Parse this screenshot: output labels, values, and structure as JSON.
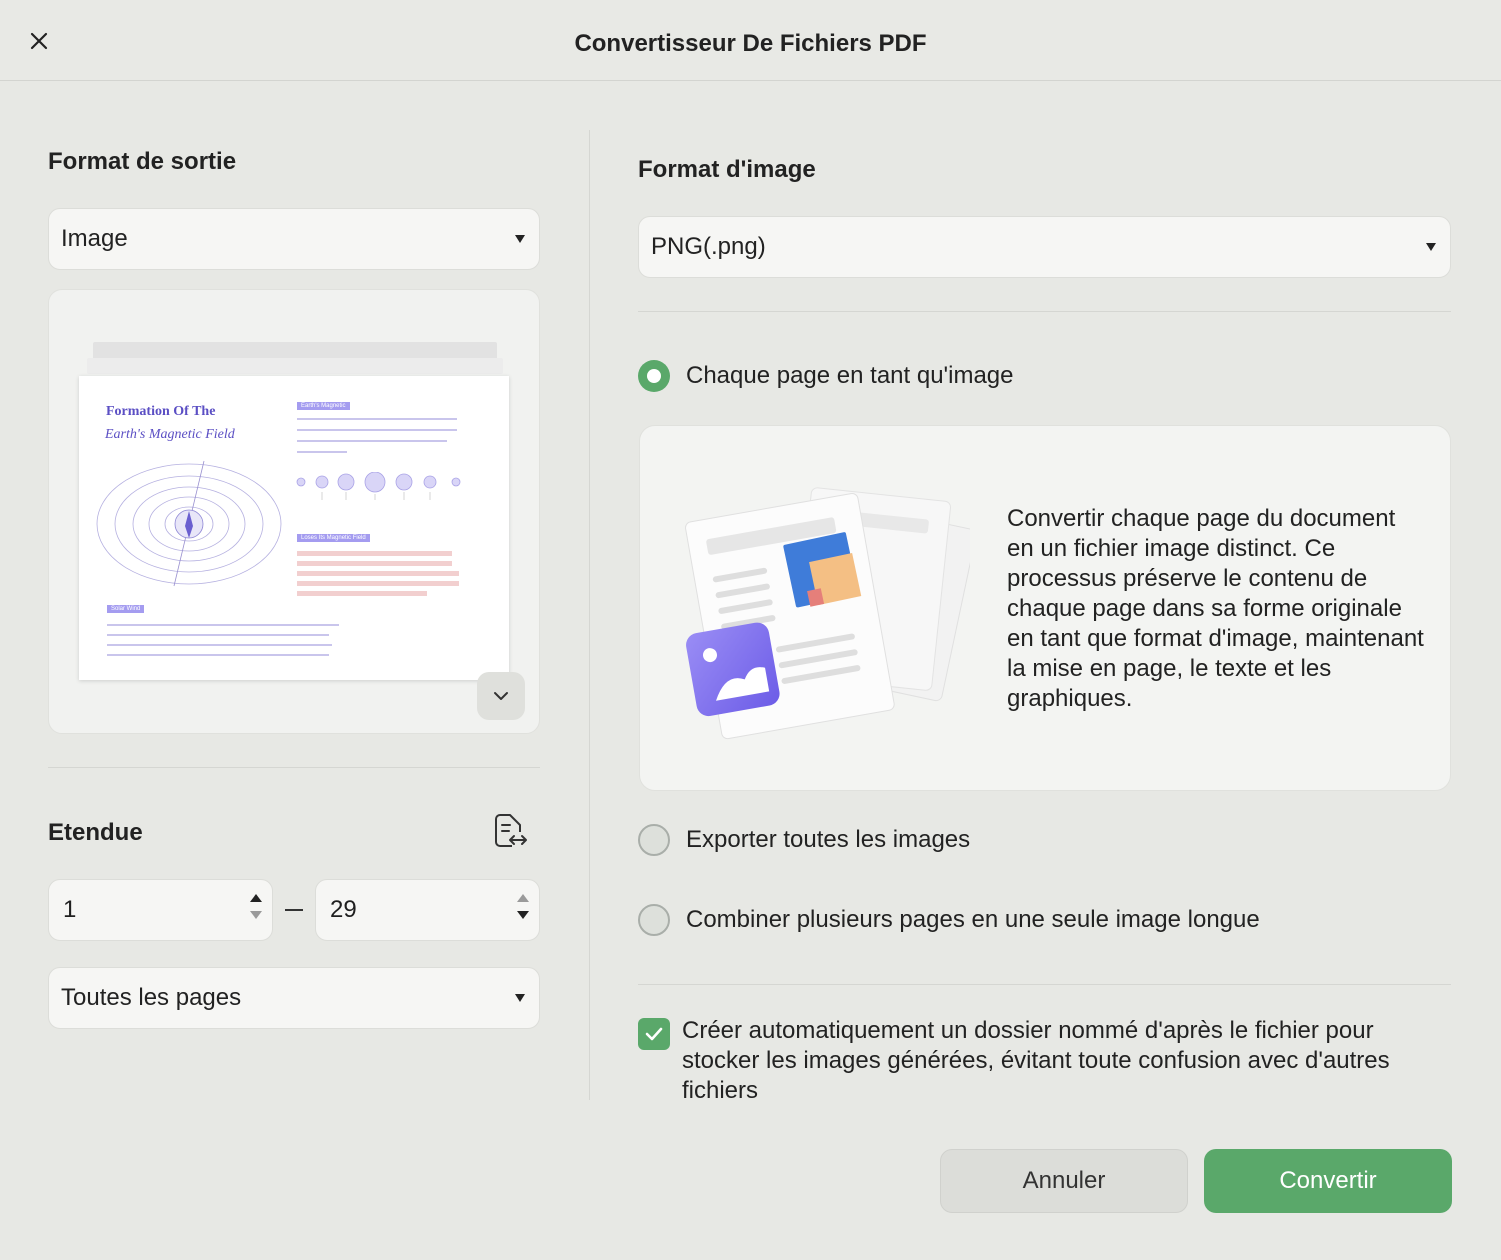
{
  "window": {
    "title": "Convertisseur De Fichiers PDF",
    "close_icon": "close-icon"
  },
  "left": {
    "output_format_label": "Format de sortie",
    "output_format_value": "Image",
    "preview": {
      "doc_title_line1": "Formation Of The",
      "doc_title_line2": "Earth's Magnetic Field",
      "tag_1": "Earth's Magnetic",
      "tag_2": "Loses Its Magnetic Field",
      "tag_3": "Solar Wind"
    },
    "range_label": "Etendue",
    "range_from": "1",
    "range_to": "29",
    "pages_select_value": "Toutes les pages"
  },
  "right": {
    "image_format_label": "Format d'image",
    "image_format_value": "PNG(.png)",
    "options": [
      {
        "label": "Chaque page en tant qu'image",
        "selected": true
      },
      {
        "label": "Exporter toutes les images",
        "selected": false
      },
      {
        "label": "Combiner plusieurs pages en une seule image longue",
        "selected": false
      }
    ],
    "description": "Convertir chaque page du document en un fichier image distinct. Ce processus préserve le contenu de chaque page dans sa forme originale en tant que format d'image, maintenant la mise en page, le texte et les graphiques.",
    "auto_folder_checked": true,
    "auto_folder_label": "Créer automatiquement un dossier nommé d'après le fichier pour stocker les images générées, évitant toute confusion avec d'autres fichiers"
  },
  "footer": {
    "cancel_label": "Annuler",
    "convert_label": "Convertir"
  },
  "colors": {
    "accent": "#5aa86a",
    "background": "#e7e8e4",
    "illustration_purple": "#7b6cf0"
  }
}
